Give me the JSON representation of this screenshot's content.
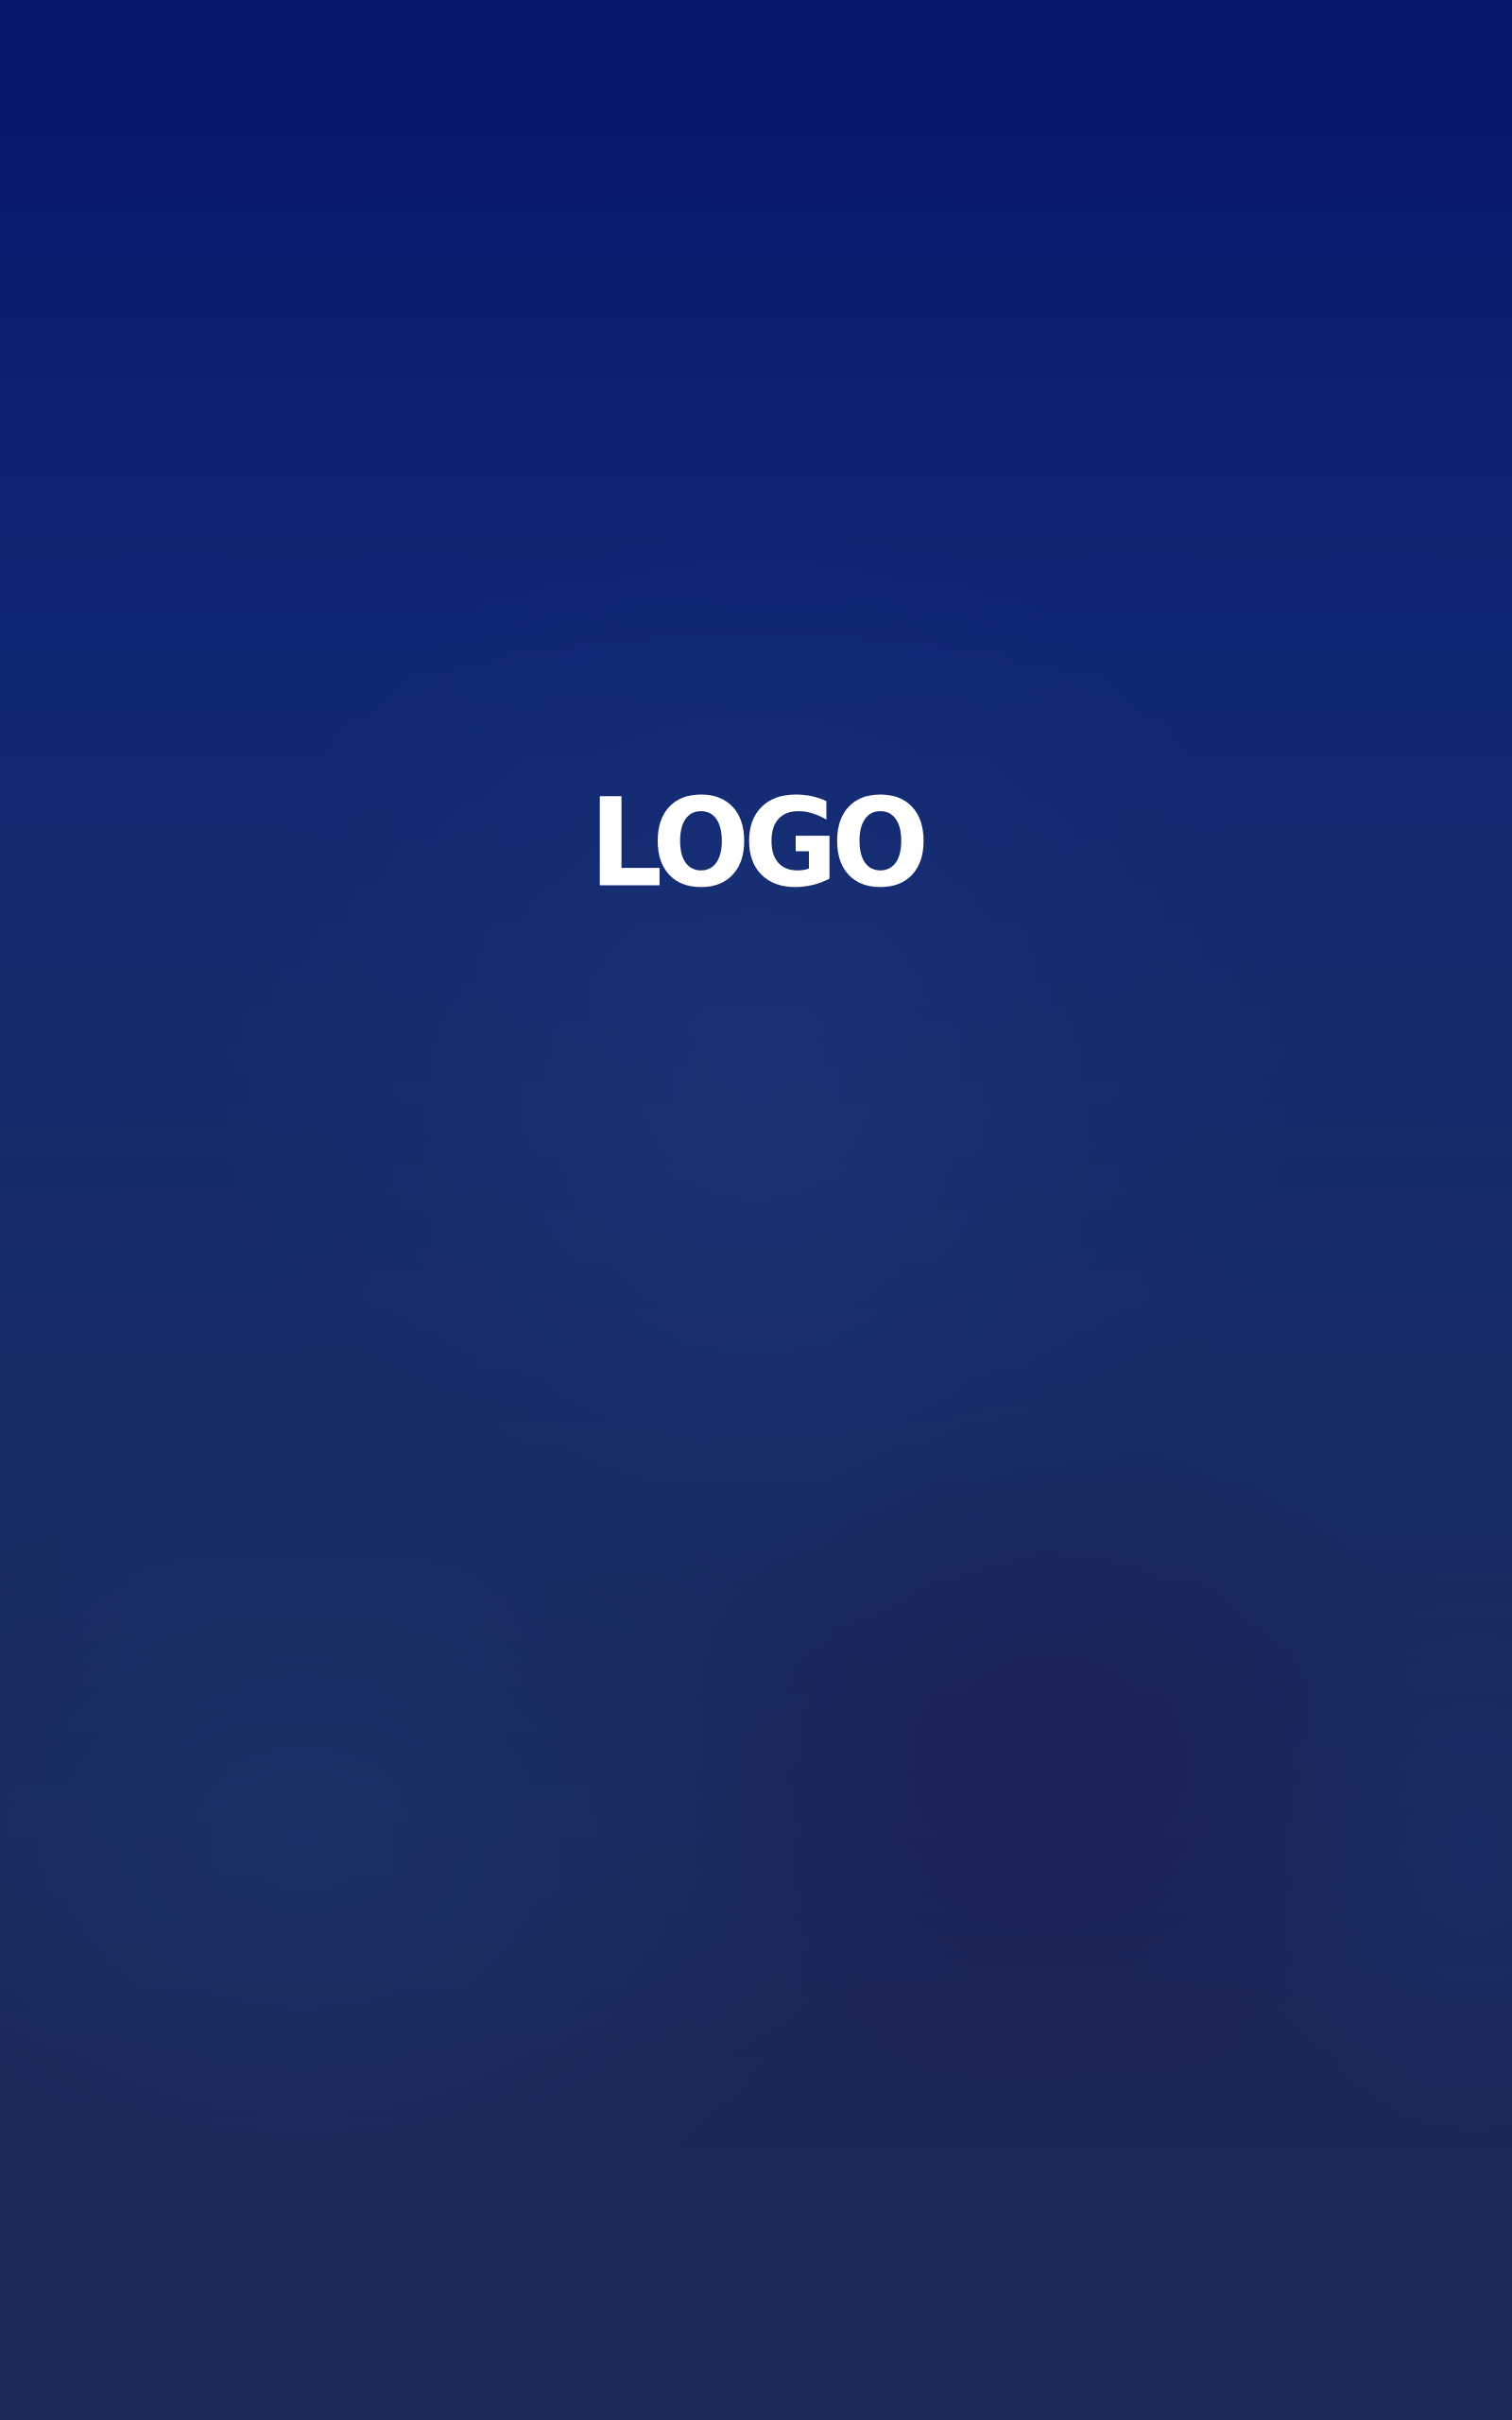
{
  "splash": {
    "logo_text": "LOGO"
  },
  "colors": {
    "background_top": "#08186a",
    "background_middle": "#172c66",
    "background_bottom": "#1c2a57",
    "logo": "#ffffff"
  }
}
